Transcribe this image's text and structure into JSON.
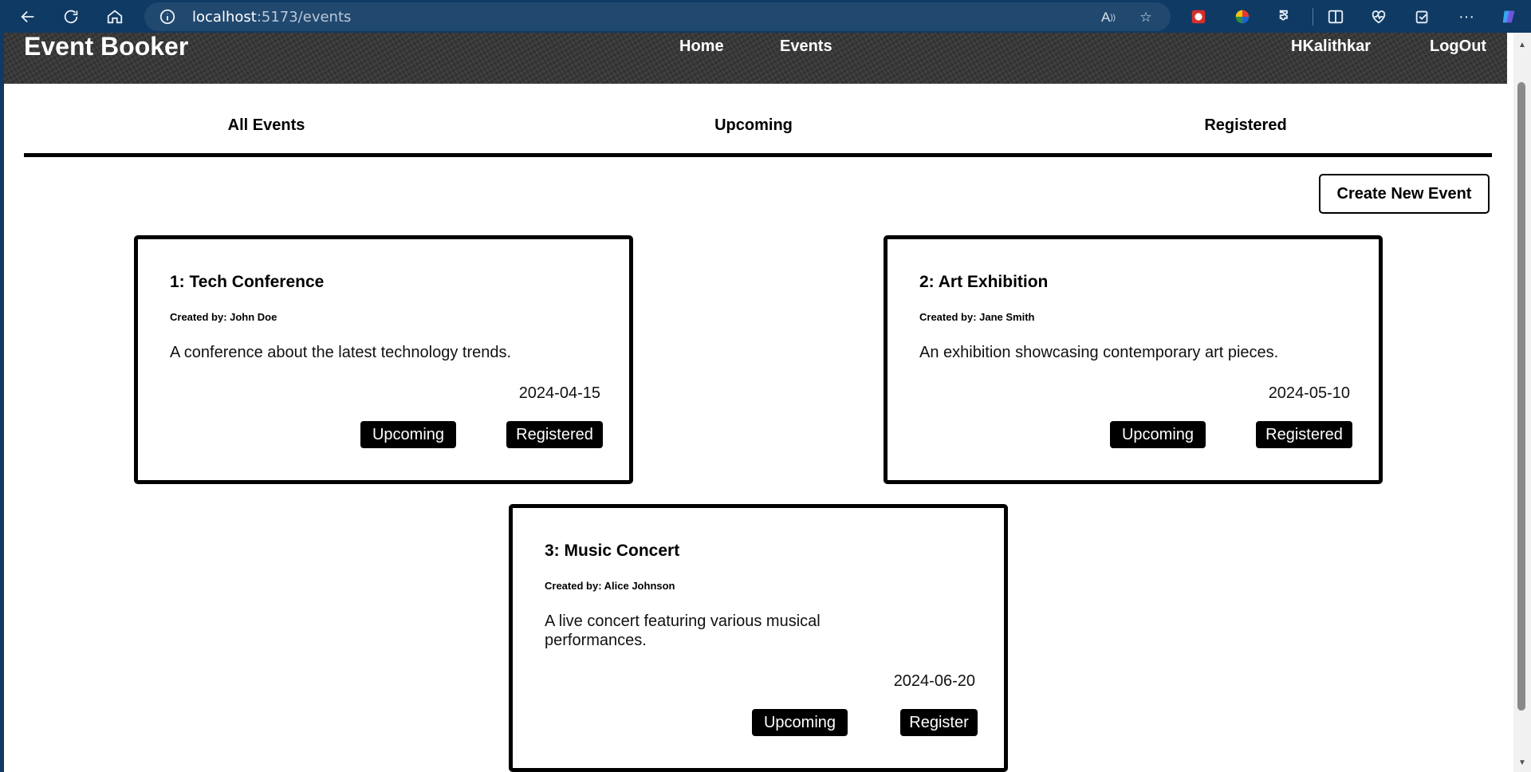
{
  "browser": {
    "url_host": "localhost",
    "url_path": ":5173/events"
  },
  "header": {
    "brand": "Event Booker",
    "nav": [
      "Home",
      "Events"
    ],
    "user": "HKalithkar",
    "logout": "LogOut"
  },
  "tabs": [
    "All Events",
    "Upcoming",
    "Registered"
  ],
  "create_button": "Create New Event",
  "events": [
    {
      "title": "1: Tech Conference",
      "creator": "Created by: John Doe",
      "description": "A conference about the latest technology trends.",
      "date": "2024-04-15",
      "status": "Upcoming",
      "action": "Registered"
    },
    {
      "title": "2: Art Exhibition",
      "creator": "Created by: Jane Smith",
      "description": "An exhibition showcasing contemporary art pieces.",
      "date": "2024-05-10",
      "status": "Upcoming",
      "action": "Registered"
    },
    {
      "title": "3: Music Concert",
      "creator": "Created by: Alice Johnson",
      "description": "A live concert featuring various musical performances.",
      "date": "2024-06-20",
      "status": "Upcoming",
      "action": "Register"
    }
  ],
  "colors": {
    "browser_chrome": "#0f3a63",
    "card_border": "#000000",
    "pill_bg": "#000000"
  }
}
